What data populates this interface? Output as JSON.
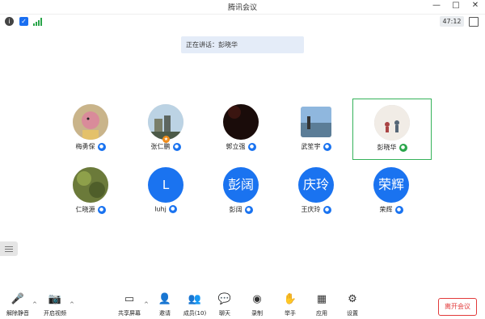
{
  "window": {
    "title": "腾讯会议",
    "controls": [
      "—",
      "□",
      "✕"
    ]
  },
  "status": {
    "timer": "47:12"
  },
  "speaking": {
    "text": "正在讲话：彭晓华"
  },
  "participants": [
    {
      "name": "梅勇保",
      "avatar": "photo-bird",
      "avatar_text": ""
    },
    {
      "name": "张仁鹏",
      "avatar": "photo-building",
      "avatar_text": ""
    },
    {
      "name": "郭立强",
      "avatar": "photo-dark",
      "avatar_text": ""
    },
    {
      "name": "武笙宇",
      "avatar": "photo-beach",
      "avatar_text": ""
    },
    {
      "name": "彭晓华",
      "avatar": "photo-sketch",
      "avatar_text": ""
    },
    {
      "name": "仁晓源",
      "avatar": "photo-leaves",
      "avatar_text": ""
    },
    {
      "name": "luhj",
      "avatar": "letter",
      "avatar_text": "L"
    },
    {
      "name": "彭阔",
      "avatar": "text",
      "avatar_text": "彭阔"
    },
    {
      "name": "王庆玲",
      "avatar": "text",
      "avatar_text": "庆玲"
    },
    {
      "name": "荣辉",
      "avatar": "text",
      "avatar_text": "荣辉"
    }
  ],
  "toolbar": {
    "mute": "解除静音",
    "video": "开启视频",
    "share": "共享屏幕",
    "invite": "邀请",
    "members": "成员(10)",
    "chat": "聊天",
    "record": "录制",
    "raise_hand": "举手",
    "apps": "应用",
    "settings": "设置",
    "leave": "离开会议"
  },
  "colors": {
    "accent": "#1a73f0",
    "active_border": "#35b25a",
    "leave": "#e23a3a"
  }
}
